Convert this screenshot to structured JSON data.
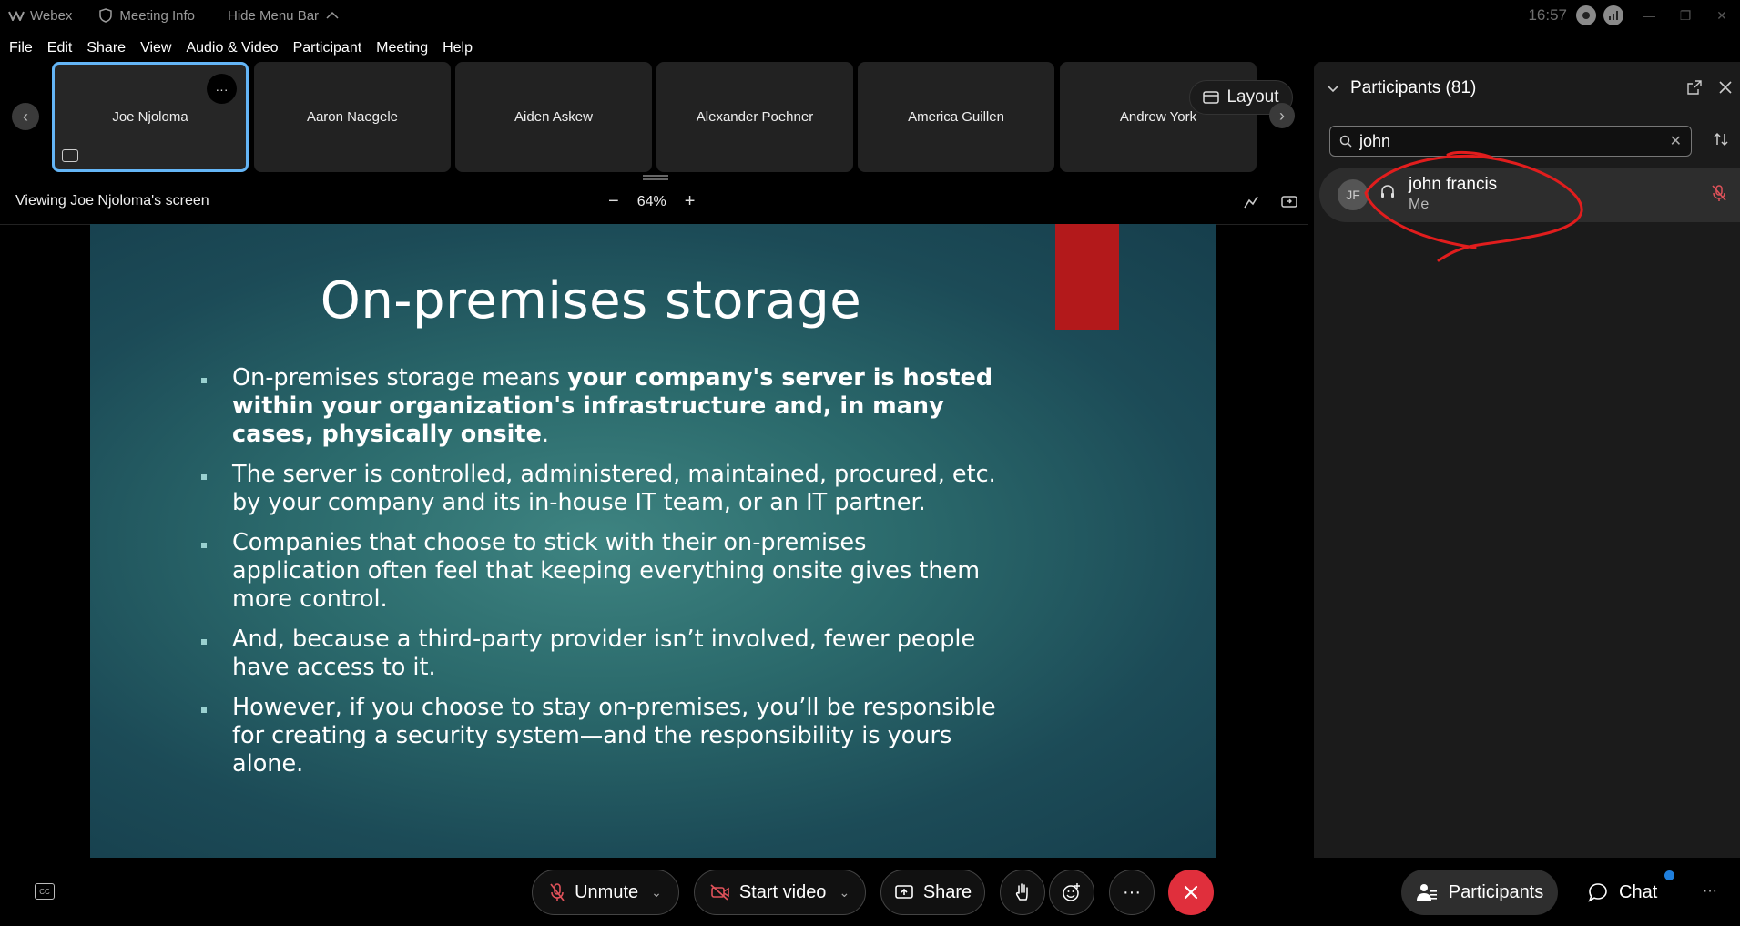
{
  "titlebar": {
    "app_name": "Webex",
    "meeting_info": "Meeting Info",
    "hide_menu_bar": "Hide Menu Bar",
    "clock": "16:57"
  },
  "menu": [
    "File",
    "Edit",
    "Share",
    "View",
    "Audio & Video",
    "Participant",
    "Meeting",
    "Help"
  ],
  "filmstrip": {
    "tiles": [
      "Joe Njoloma",
      "Aaron Naegele",
      "Aiden Askew",
      "Alexander Poehner",
      "America Guillen",
      "Andrew York"
    ],
    "more_label": "···",
    "layout_label": "Layout"
  },
  "share_bar": {
    "viewing_text": "Viewing Joe Njoloma's screen",
    "zoom": "64%",
    "zoom_out": "−",
    "zoom_in": "+"
  },
  "slide": {
    "title": "On-premises storage",
    "bullets": [
      {
        "plain": " On-premises storage means ",
        "bold": "your company's server is hosted within your organization's infrastructure and, in many cases, physically onsite",
        "tail": "."
      },
      {
        "plain": "The server is controlled, administered, maintained, procured, etc. by your company and its in-house IT team, or an IT partner.",
        "bold": "",
        "tail": ""
      },
      {
        "plain": "Companies that choose to stick with their on-premises application often feel that keeping everything onsite gives them more control.",
        "bold": "",
        "tail": ""
      },
      {
        "plain": " And, because a third-party provider isn’t involved, fewer people have access to it.",
        "bold": "",
        "tail": ""
      },
      {
        "plain": "However, if you choose to stay on-premises, you’ll be responsible for creating a security system—and the responsibility is yours alone.",
        "bold": "",
        "tail": ""
      }
    ],
    "accent_color": "#b3191b"
  },
  "participants_panel": {
    "title": "Participants (81)",
    "search_value": "john",
    "results": [
      {
        "initials": "JF",
        "name": "john francis",
        "subtitle": "Me"
      }
    ]
  },
  "controls": {
    "unmute": "Unmute",
    "start_video": "Start video",
    "share": "Share",
    "more": "···",
    "participants": "Participants",
    "chat": "Chat",
    "cc": "CC",
    "leave_color": "#e02f3c"
  }
}
